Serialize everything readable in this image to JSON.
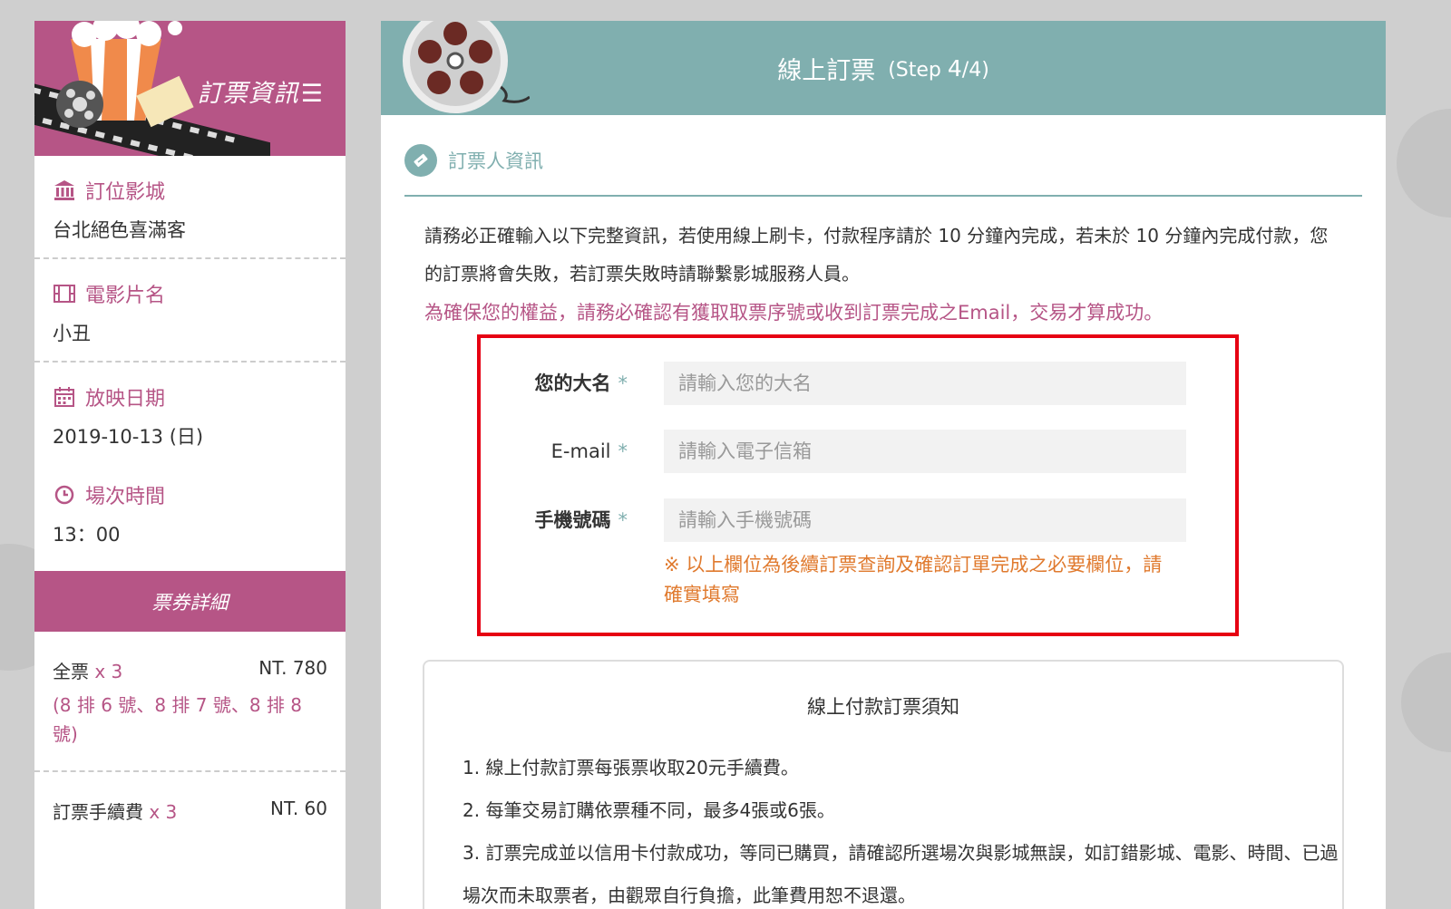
{
  "sidebar": {
    "header_title": "訂票資訊",
    "cinema": {
      "label": "訂位影城",
      "value": "台北絕色喜滿客"
    },
    "movie": {
      "label": "電影片名",
      "value": "小丑"
    },
    "date": {
      "label": "放映日期",
      "value": "2019-10-13 (日)"
    },
    "time": {
      "label": "場次時間",
      "value": "13：00"
    },
    "ticket_details_title": "票券詳細",
    "tickets": [
      {
        "name": "全票",
        "qty": "x 3",
        "price": "NT. 780",
        "seats": "(8 排 6 號、8 排 7 號、8 排 8 號)"
      },
      {
        "name": "訂票手續費",
        "qty": "x 3",
        "price": "NT. 60"
      }
    ]
  },
  "main": {
    "title": "線上訂票",
    "step_prefix": "(Step ",
    "step_num": "4",
    "step_suffix": "/4)",
    "section_title": "訂票人資訊",
    "notice": "請務必正確輸入以下完整資訊，若使用線上刷卡，付款程序請於 10 分鐘內完成，若未於 10 分鐘內完成付款，您的訂票將會失敗，若訂票失敗時請聯繫影城服務人員。",
    "warning": "為確保您的權益，請務必確認有獲取取票序號或收到訂票完成之Email，交易才算成功。",
    "form": {
      "name_label": "您的大名",
      "name_placeholder": "請輸入您的大名",
      "email_label": "E-mail",
      "email_placeholder": "請輸入電子信箱",
      "phone_label": "手機號碼",
      "phone_placeholder": "請輸入手機號碼",
      "required_mark": "*",
      "note": "※ 以上欄位為後續訂票查詢及確認訂單完成之必要欄位，請確實填寫"
    },
    "rules": {
      "title": "線上付款訂票須知",
      "items": [
        "1. 線上付款訂票每張票收取20元手續費。",
        "2. 每筆交易訂購依票種不同，最多4張或6張。",
        "3. 訂票完成並以信用卡付款成功，等同已購買，請確認所選場次與影城無誤，如訂錯影城、電影、時間、已過場次而未取票者，由觀眾自行負擔，此筆費用恕不退還。"
      ]
    }
  },
  "colors": {
    "brand": "#b65586",
    "teal": "#80afaf",
    "highlight": "#e60012",
    "note": "#e07a2e"
  }
}
